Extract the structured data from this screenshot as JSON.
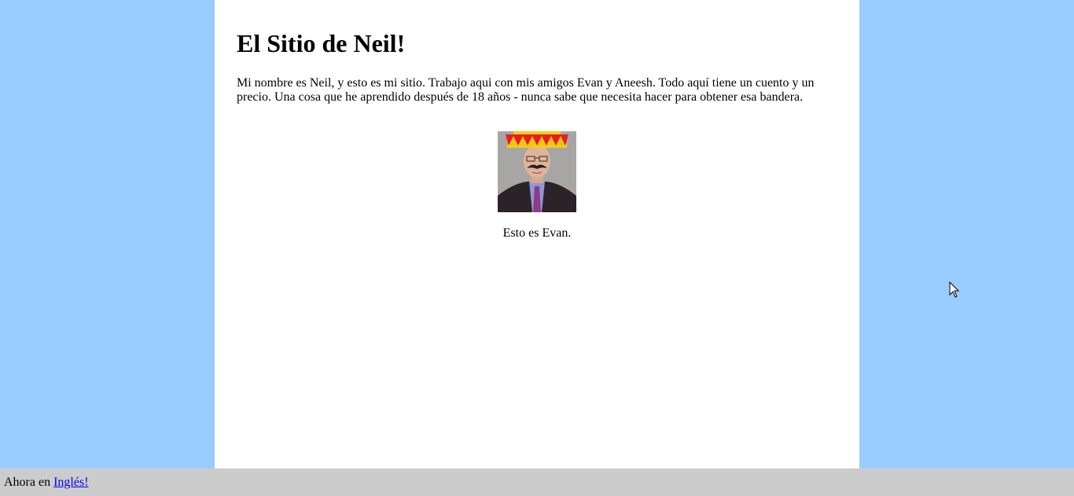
{
  "page": {
    "title": "El Sitio de Neil!",
    "intro": "Mi nombre es Neil, y esto es mi sitio. Trabajo aqui con mis amigos Evan y Aneesh. Todo aquí tiene un cuento y un precio. Una cosa que he aprendido después de 18 años - nunca sabe que necesita hacer para obtener esa bandera.",
    "photo_caption": "Esto es Evan."
  },
  "footer": {
    "prefix": "Ahora en",
    "link_label": "Inglés!"
  },
  "colors": {
    "background": "#99ccff",
    "page": "#ffffff",
    "footer": "#cccccc",
    "link": "#0000ee"
  }
}
